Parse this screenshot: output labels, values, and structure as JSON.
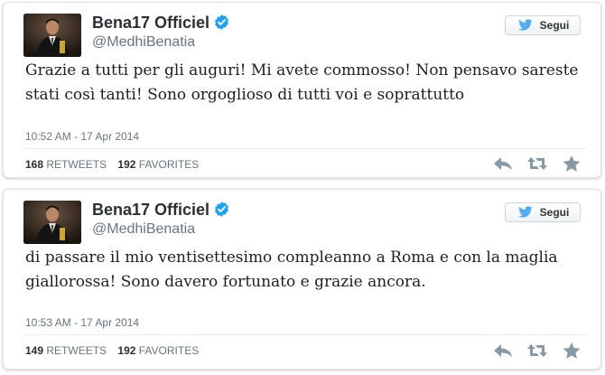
{
  "colors": {
    "text": "#292f33",
    "muted": "#66757f",
    "verified": "#1da1f2",
    "action": "#8899a6"
  },
  "tweets": [
    {
      "name": "Bena17 Officiel",
      "handle": "@MedhiBenatia",
      "follow_label": "Segui",
      "text": "Grazie a tutti per gli auguri! Mi avete commosso! Non pensavo sareste stati così tanti! Sono orgoglioso di tutti voi e soprattutto",
      "time": "10:52 AM - 17 Apr 2014",
      "retweets_count": "168",
      "retweets_label": "RETWEETS",
      "favorites_count": "192",
      "favorites_label": "FAVORITES"
    },
    {
      "name": "Bena17 Officiel",
      "handle": "@MedhiBenatia",
      "follow_label": "Segui",
      "text": "di passare il mio ventisettesimo compleanno a Roma e con la maglia giallorossa! Sono davero fortunato e grazie ancora.",
      "time": "10:53 AM - 17 Apr 2014",
      "retweets_count": "149",
      "retweets_label": "RETWEETS",
      "favorites_count": "192",
      "favorites_label": "FAVORITES"
    }
  ]
}
